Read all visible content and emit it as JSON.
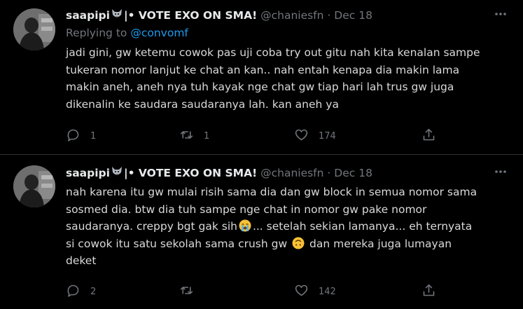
{
  "tweets": [
    {
      "display_name": "saapipi",
      "name_suffix": "|• VOTE EXO ON SMA!",
      "handle": "@chaniesfn",
      "separator": "·",
      "date": "Dec 18",
      "replying_to_label": "Replying to",
      "replying_to_mention": "@convomf",
      "lines": [
        "jadi gini, gw ketemu cowok pas uji coba try out gitu nah kita kenalan sampe",
        "tukeran nomor lanjut ke chat an kan.. nah entah kenapa dia makin lama",
        "makin aneh, aneh nya tuh kayak nge chat gw tiap hari lah trus gw juga",
        "dikenalin ke saudara saudaranya lah. kan aneh ya"
      ],
      "reply_count": "1",
      "retweet_count": "1",
      "like_count": "174"
    },
    {
      "display_name": "saapipi",
      "name_suffix": "|• VOTE EXO ON SMA!",
      "handle": "@chaniesfn",
      "separator": "·",
      "date": "Dec 18",
      "line1": "nah karena itu gw mulai risih sama dia dan gw block in semua nomor sama",
      "line2": "sosmed dia. btw dia tuh sampe nge chat in nomor gw pake nomor",
      "line3a": "saudaranya. creppy bgt gak sih",
      "line3b": "... setelah sekian lamanya... eh ternyata",
      "line4a": "si cowok itu satu sekolah sama crush gw ",
      "line4b": " dan mereka juga lumayan",
      "line5": "deket",
      "reply_count": "2",
      "retweet_count": "",
      "like_count": "142"
    }
  ],
  "icons": {
    "name_badge": "wolf-face-emoji",
    "emoji_1": "loudly-crying-face-emoji",
    "emoji_2": "upside-down-face-emoji",
    "reply": "reply-icon",
    "retweet": "retweet-icon",
    "like": "heart-icon",
    "share": "share-icon",
    "more": "more-options-icon"
  },
  "colors": {
    "background": "#000000",
    "text": "#d9d9d9",
    "muted": "#71767b",
    "link": "#1d9bf0",
    "divider": "#2f3336"
  }
}
